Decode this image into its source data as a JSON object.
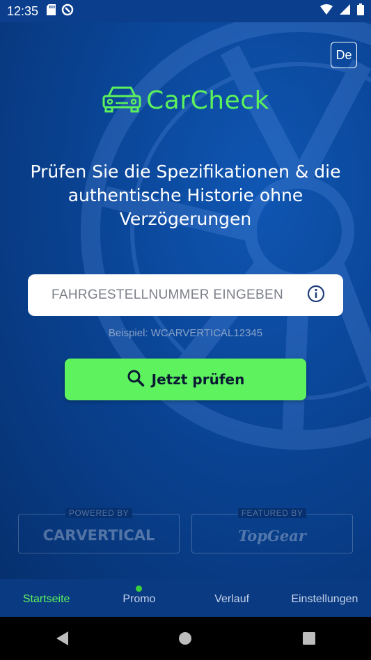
{
  "status": {
    "time": "12:35"
  },
  "language": {
    "label": "De"
  },
  "logo": {
    "text": "CarCheck"
  },
  "headline": "Prüfen Sie die Spezifikationen & die authentische Historie ohne Verzögerungen",
  "vin": {
    "placeholder": "FAHRGESTELLNUMMER EINGEBEN",
    "value": "",
    "hint": "Beispiel: WCARVERTICAL12345"
  },
  "action": {
    "check_label": "Jetzt prüfen"
  },
  "partners": [
    {
      "caption": "POWERED BY",
      "name": "CARVERTICAL"
    },
    {
      "caption": "FEATURED BY",
      "name": "TopGear"
    }
  ],
  "tabs": [
    {
      "label": "Startseite",
      "active": true
    },
    {
      "label": "Promo",
      "badge": true
    },
    {
      "label": "Verlauf"
    },
    {
      "label": "Einstellungen"
    }
  ],
  "colors": {
    "accent": "#5cf25c",
    "background": "#0a4495",
    "tabbar": "#0a3a82"
  },
  "icons": [
    "sd-card-icon",
    "sync-icon",
    "wifi-icon",
    "signal-icon",
    "battery-icon",
    "car-icon",
    "info-icon",
    "search-icon",
    "back-icon",
    "home-icon",
    "recents-icon"
  ]
}
